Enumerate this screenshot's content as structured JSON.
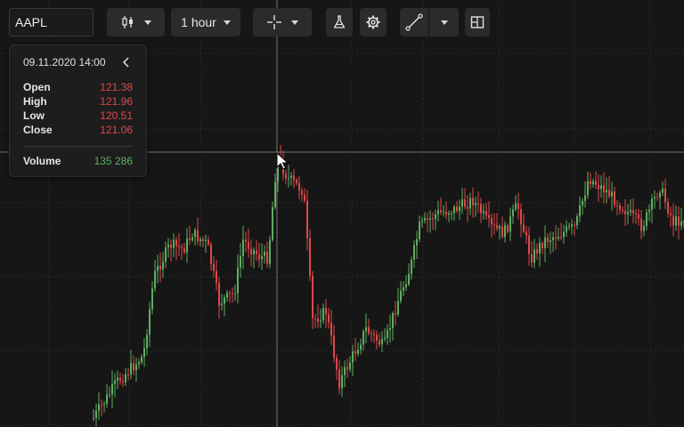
{
  "toolbar": {
    "symbol_value": "AAPL",
    "interval_label": "1 hour"
  },
  "ohlc": {
    "date": "09.11.2020 14:00",
    "open_label": "Open",
    "open_value": "121.38",
    "high_label": "High",
    "high_value": "121.96",
    "low_label": "Low",
    "low_value": "120.51",
    "close_label": "Close",
    "close_value": "121.06",
    "volume_label": "Volume",
    "volume_value": "135 286"
  },
  "colors": {
    "background": "#161616",
    "up": "#5fae5f",
    "down": "#e04848",
    "grid": "#2a2a2a",
    "crosshair": "#8a8a8a"
  },
  "icons": [
    "candles-icon",
    "crosshair-icon",
    "flask-icon",
    "gear-icon",
    "trend-line-icon",
    "layout-icon",
    "chevron-left-icon",
    "cursor-icon"
  ]
}
